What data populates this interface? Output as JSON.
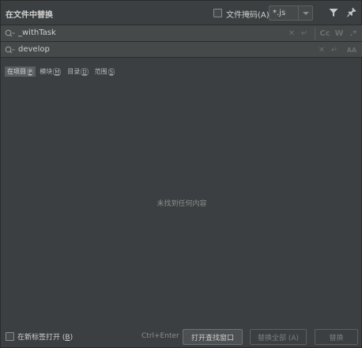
{
  "header": {
    "title": "在文件中替换",
    "file_mask_label": "文件掩码(A):",
    "file_mask_value": "*.js"
  },
  "search": {
    "find_value": "_withTask",
    "replace_value": "develop",
    "case_option": "Cc",
    "word_option": "W",
    "regex_option": ".*",
    "preserve_case_option": "AA"
  },
  "scopes": [
    {
      "label": "在项目",
      "key": "P"
    },
    {
      "label": "模块",
      "key": "M"
    },
    {
      "label": "目录",
      "key": "D"
    },
    {
      "label": "范围",
      "key": "S"
    }
  ],
  "results": {
    "empty_text": "未找到任何内容"
  },
  "footer": {
    "new_tab_label": "在新标签打开",
    "new_tab_key": "B",
    "shortcut": "Ctrl+Enter",
    "open_button": "打开查找窗口",
    "replace_all_button": "替换全部 (A)",
    "replace_button": "替换"
  },
  "icons": [
    "filter-icon",
    "pin-icon",
    "search-history-icon",
    "clear-icon",
    "newline-icon"
  ]
}
